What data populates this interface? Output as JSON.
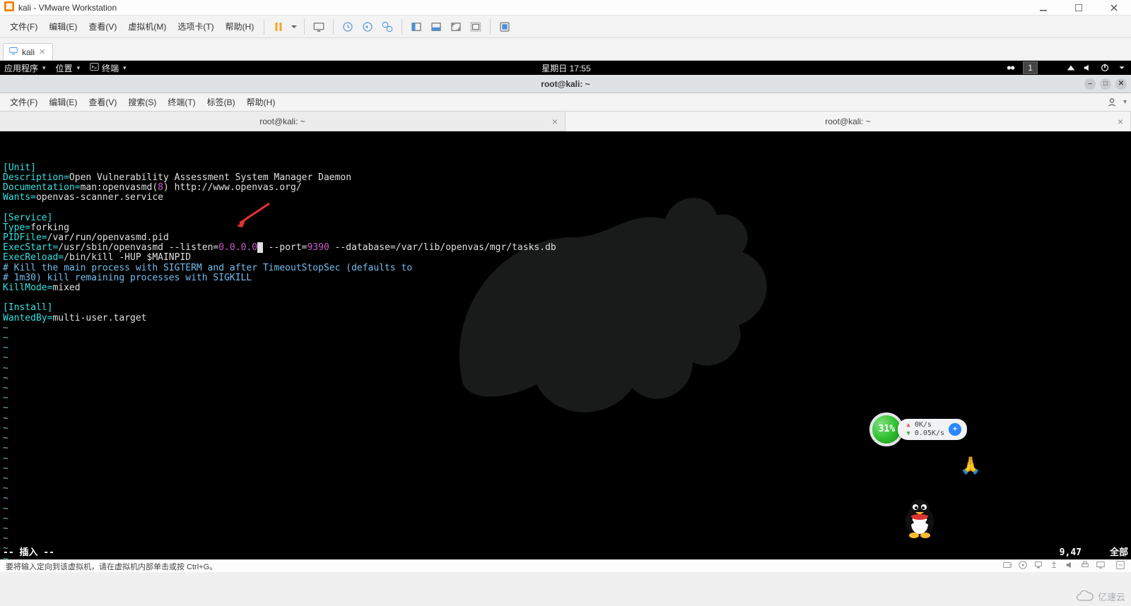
{
  "vmware": {
    "title": "kali - VMware Workstation",
    "menus": {
      "file": "文件(F)",
      "edit": "编辑(E)",
      "view": "查看(V)",
      "vm": "虚拟机(M)",
      "tabs": "选项卡(T)",
      "help": "帮助(H)"
    },
    "tab_label": "kali",
    "status": "要将输入定向到该虚拟机，请在虚拟机内部单击或按 Ctrl+G。"
  },
  "kali_topbar": {
    "apps": "应用程序",
    "places": "位置",
    "terminal": "终端",
    "clock": "星期日 17:55",
    "tray_box": "1"
  },
  "kali_window_title": "root@kali: ~",
  "kali_inner_menu": {
    "file": "文件(F)",
    "edit": "编辑(E)",
    "view": "查看(V)",
    "search": "搜索(S)",
    "terminal": "终端(T)",
    "tabs": "标签(B)",
    "help": "帮助(H)"
  },
  "kali_inner_tabs": {
    "tab1": "root@kali: ~",
    "tab2": "root@kali: ~"
  },
  "editor_content": {
    "unit_header": "[Unit]",
    "desc_k": "Description=",
    "desc_v": "Open Vulnerability Assessment System Manager Daemon",
    "doc_k": "Documentation=",
    "doc_v": "man:openvasmd(",
    "doc_n": "8",
    "doc_v2": ") http://www.openvas.org/",
    "wants_k": "Wants=",
    "wants_v": "openvas-scanner.service",
    "service_header": "[Service]",
    "type_k": "Type=",
    "type_v": "forking",
    "pid_k": "PIDFile=",
    "pid_v": "/var/run/openvasmd.pid",
    "exec_k": "ExecStart=",
    "exec_v1": "/usr/sbin/openvasmd --listen=",
    "exec_ip": "0.0.0.0",
    "exec_v2": " --port=",
    "exec_port": "9390",
    "exec_v3": " --database=/var/lib/openvas/mgr/tasks.db",
    "reload_k": "ExecReload=",
    "reload_v": "/bin/kill -HUP $MAINPID",
    "comment1": "# Kill the main process with SIGTERM and after TimeoutStopSec (defaults to",
    "comment2": "# 1m30) kill remaining processes with SIGKILL",
    "kill_k": "KillMode=",
    "kill_v": "mixed",
    "install_header": "[Install]",
    "wanted_k": "WantedBy=",
    "wanted_v": "multi-user.target",
    "tilde": "~"
  },
  "vim": {
    "mode": "-- 插入 --",
    "pos": "9,47",
    "extent": "全部"
  },
  "monitor": {
    "pct": "31%",
    "up": "0K/s",
    "down": "0.05K/s"
  },
  "watermark": "亿速云"
}
